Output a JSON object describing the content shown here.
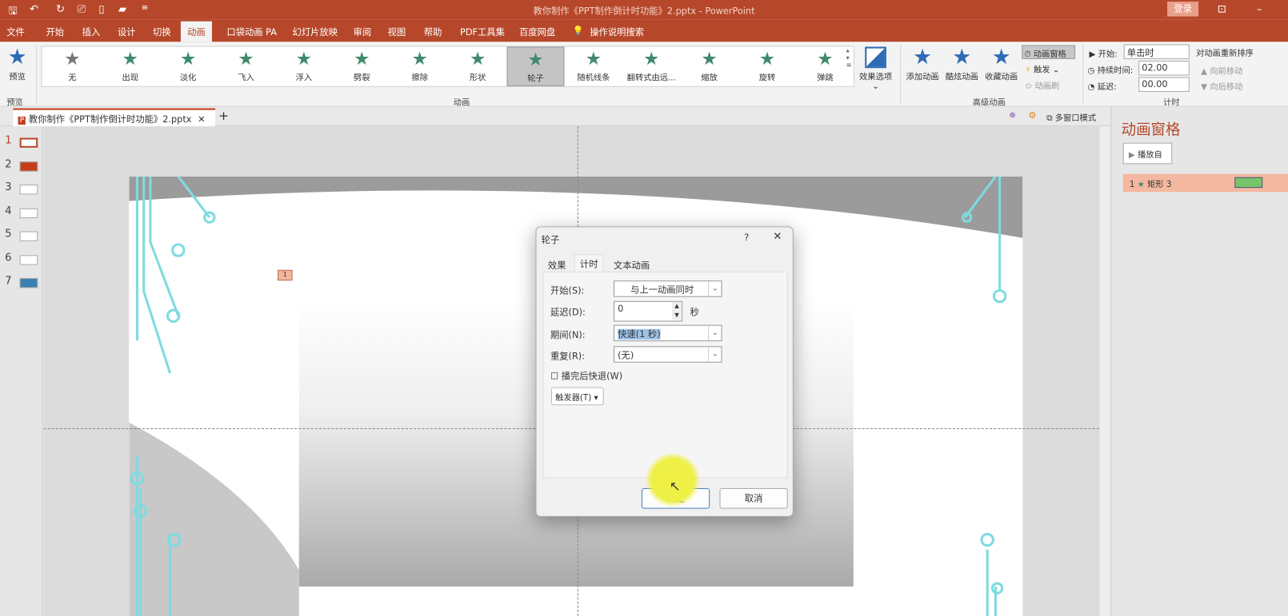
{
  "titlebar": {
    "title": "教你制作《PPT制作倒计时功能》2.pptx  -  PowerPoint",
    "login": "登录"
  },
  "menu": [
    "文件",
    "开始",
    "插入",
    "设计",
    "切换",
    "动画",
    "口袋动画 PA",
    "幻灯片放映",
    "审阅",
    "视图",
    "帮助",
    "PDF工具集",
    "百度网盘",
    "操作说明搜索"
  ],
  "ribbon": {
    "preview": "预览",
    "preview_group": "预览",
    "animations": [
      "无",
      "出现",
      "淡化",
      "飞入",
      "浮入",
      "劈裂",
      "擦除",
      "形状",
      "轮子",
      "随机线条",
      "翻转式由远...",
      "缩放",
      "旋转",
      "弹跳"
    ],
    "selected_animation": "轮子",
    "effect_options": "效果选项",
    "animation_group": "动画",
    "add_animation": "添加动画",
    "cool_animation": "酷炫动画",
    "fav_animation": "收藏动画",
    "animation_pane": "动画窗格",
    "trigger": "触发",
    "painter": "动画刷",
    "advanced_group": "高级动画",
    "start_label": "开始:",
    "start_value": "单击时",
    "duration_label": "持续时间:",
    "duration_value": "02.00",
    "delay_label": "延迟:",
    "delay_value": "00.00",
    "reorder": "对动画重新排序",
    "move_earlier": "向前移动",
    "move_later": "向后移动",
    "timing_group": "计时"
  },
  "tabbar": {
    "doc_tab": "教你制作《PPT制作倒计时功能》2.pptx",
    "multiwindow": "多窗口模式"
  },
  "slides": [
    "1",
    "2",
    "3",
    "4",
    "5",
    "6",
    "7"
  ],
  "slide": {
    "tag": "1"
  },
  "pane": {
    "title": "动画窗格",
    "play_from": "播放自",
    "item_index": "1",
    "item_name": "矩形 3"
  },
  "dialog": {
    "title": "轮子",
    "help": "?",
    "tabs": [
      "效果",
      "计时",
      "文本动画"
    ],
    "start_label": "开始(S):",
    "start_value": "与上一动画同时",
    "delay_label": "延迟(D):",
    "delay_value": "0",
    "delay_unit": "秒",
    "period_label": "期间(N):",
    "period_value": "快速(1 秒)",
    "repeat_label": "重复(R):",
    "repeat_value": "(无)",
    "rewind_label": "播完后快退(W)",
    "rewind_checked": false,
    "trigger_label": "触发器(T)",
    "ok": "确定",
    "cancel": "取消"
  },
  "colors": {
    "brand": "#b7472a",
    "star": "#3f8a6c",
    "pane_item": "#f4b8a0",
    "timeline_bar": "#77c46a"
  }
}
